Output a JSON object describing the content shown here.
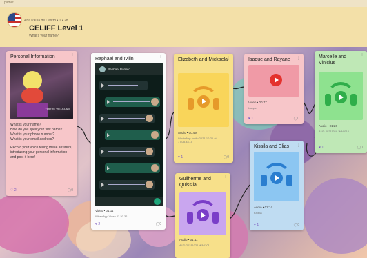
{
  "app": {
    "logo": "padlet"
  },
  "header": {
    "author_line": "Ana Paula de Castro • 1 • 2d",
    "title": "CELIFF Level 1",
    "subtitle": "What's your name?",
    "flag_icon": "usa-flag-icon"
  },
  "cards": {
    "personal": {
      "title": "Personal Information",
      "color": "#f7c6c9",
      "image_caption": "YOU'RE WELCOME",
      "lines": [
        "What is your name?",
        "How do you spell your first name?",
        "What is your phone number?",
        "What is your email address?",
        "",
        "Record your voice telling these answers, introducing your personal information and post it here!"
      ],
      "likes": "2",
      "comments": "0"
    },
    "raphael": {
      "title": "Raphael and Ivilin",
      "contact": "Raphael Barreto",
      "caption": "Video • 01:11",
      "sub": "WhatsApp Video 03.20.32",
      "likes": "2",
      "comments": "0"
    },
    "elizabeth": {
      "title": "Elizabeth and Mickaela",
      "color": "#f7e08a",
      "thumb_color": "#f5b43a",
      "caption": "Audio • 00:49",
      "sub": "WhatsApp Audio 2021-10-20 at 17.05.33.15",
      "likes": "1",
      "comments": "0"
    },
    "isaque": {
      "title": "Isaque and Rayane",
      "color": "#f7c6c9",
      "caption": "Video • 00:47",
      "sub": "Isaque",
      "likes": "1",
      "comments": "0"
    },
    "marcelle": {
      "title": "Marcelle and Vinicius",
      "color": "#bfe8b6",
      "thumb_color": "#5ccf6a",
      "caption": "Audio • 01:26",
      "sub": "AUD-20211019-WA0018",
      "likes": "1",
      "comments": "0"
    },
    "kissila": {
      "title": "Kissila and Elias",
      "color": "#bfdcf2",
      "thumb_color": "#5aa8e6",
      "caption": "Audio • 02:14",
      "sub": "Kissila",
      "likes": "1",
      "comments": "0"
    },
    "guilherme": {
      "title": "Guilherme and Quissila",
      "color": "#f7e08a",
      "thumb_color": "#9b6cd6",
      "caption": "Audio • 01:11",
      "sub": "AUD-20211022-WA0201",
      "likes": "1",
      "comments": "0"
    }
  }
}
